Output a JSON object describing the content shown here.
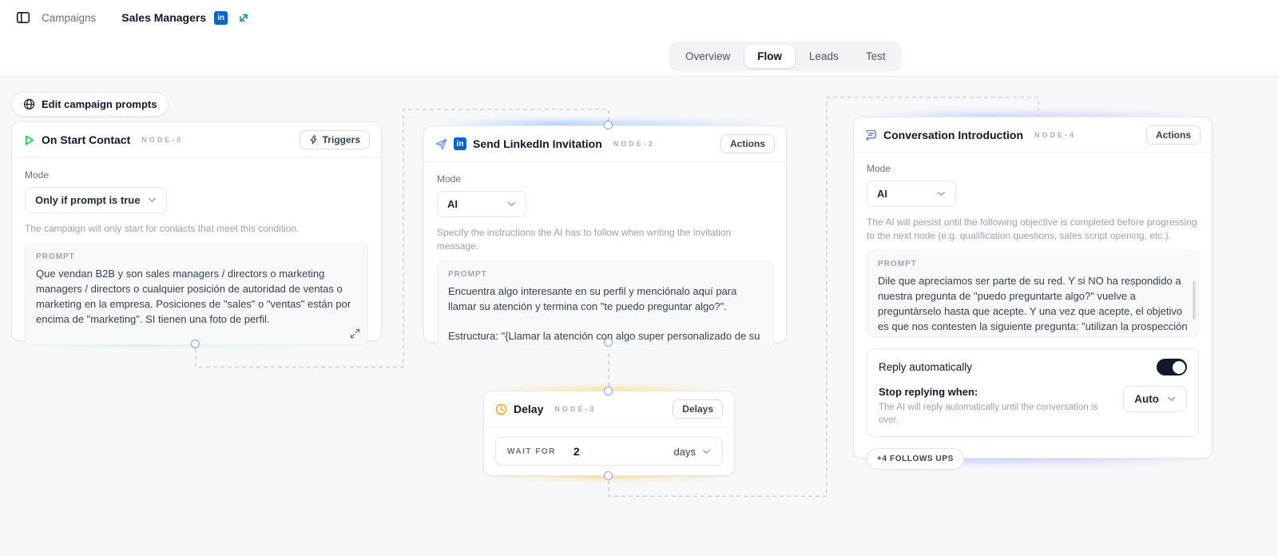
{
  "header": {
    "breadcrumb": "Campaigns",
    "title": "Sales Managers",
    "linkedin_badge": "in"
  },
  "tabs": [
    {
      "label": "Overview"
    },
    {
      "label": "Flow"
    },
    {
      "label": "Leads"
    },
    {
      "label": "Test"
    }
  ],
  "canvas": {
    "edit_button": "Edit campaign prompts"
  },
  "nodes": {
    "on_start": {
      "title": "On Start Contact",
      "node_id": "NODE-0",
      "badge": "Triggers",
      "mode_label": "Mode",
      "mode_value": "Only if prompt is true",
      "helper": "The campaign will only start for contacts that meet this condition.",
      "prompt_label": "PROMPT",
      "prompt_text": "Que vendan B2B y son sales managers / directors o marketing managers / directors o cualquier posición de autoridad de ventas o marketing en la empresa. Posiciones de \"sales\" o \"ventas\" están por encima de \"marketing\". SI tienen una foto de perfil."
    },
    "send_invitation": {
      "title": "Send LinkedIn Invitation",
      "node_id": "NODE-2",
      "linkedin_badge": "in",
      "badge": "Actions",
      "mode_label": "Mode",
      "mode_value": "AI",
      "helper": "Specify the instructions the AI has to follow when writing the invitation message.",
      "prompt_label": "PROMPT",
      "prompt_text_1": "Encuentra algo interesante en su perfil y menciónalo aquí para llamar su atención y termina con \"te puedo preguntar algo?\".",
      "prompt_text_2": "Estructura: \"{Llamar la atención con algo super personalizado de su"
    },
    "delay": {
      "title": "Delay",
      "node_id": "NODE-3",
      "badge": "Delays",
      "wait_label": "WAIT FOR",
      "wait_value": "2",
      "wait_unit": "days"
    },
    "conversation": {
      "title": "Conversation Introduction",
      "node_id": "NODE-4",
      "badge": "Actions",
      "mode_label": "Mode",
      "mode_value": "AI",
      "helper": "The AI will persist until the following objective is completed before progressing to the next node (e.g. qualification questions, sales script opening, etc.).",
      "prompt_label": "PROMPT",
      "prompt_text": "Dile que apreciamos ser parte de su red. Y si NO ha respondido a nuestra pregunta de \"puedo preguntarte algo?\" vuelve a preguntárselo hasta que acepte. Y una vez que acepte, el objetivo es que nos contesten la siguiente pregunta: \"utilizan la prospección",
      "reply_label": "Reply automatically",
      "stop_label": "Stop replying when:",
      "stop_helper": "The AI will reply automatically until the conversation is over.",
      "stop_value": "Auto",
      "follow_ups": "+4 FOLLOWS UPS"
    }
  },
  "colors": {
    "linkedin_blue": "#0a66c2",
    "trigger_green": "#22c55e",
    "delay_amber": "#f59e0b",
    "conversation_indigo": "#6366f1",
    "external_link_teal": "#0d9488",
    "toggle_on": "#111827"
  },
  "icons": {
    "sidebar-toggle-icon": "panel-left",
    "linkedin-icon": "in",
    "external-link-icon": "↗",
    "globe-icon": "globe",
    "play-icon": "▷",
    "zap-icon": "⚡",
    "send-icon": "➤",
    "clock-icon": "clock",
    "chat-icon": "💬",
    "chevron-down-icon": "⌄",
    "expand-icon": "⤢"
  }
}
